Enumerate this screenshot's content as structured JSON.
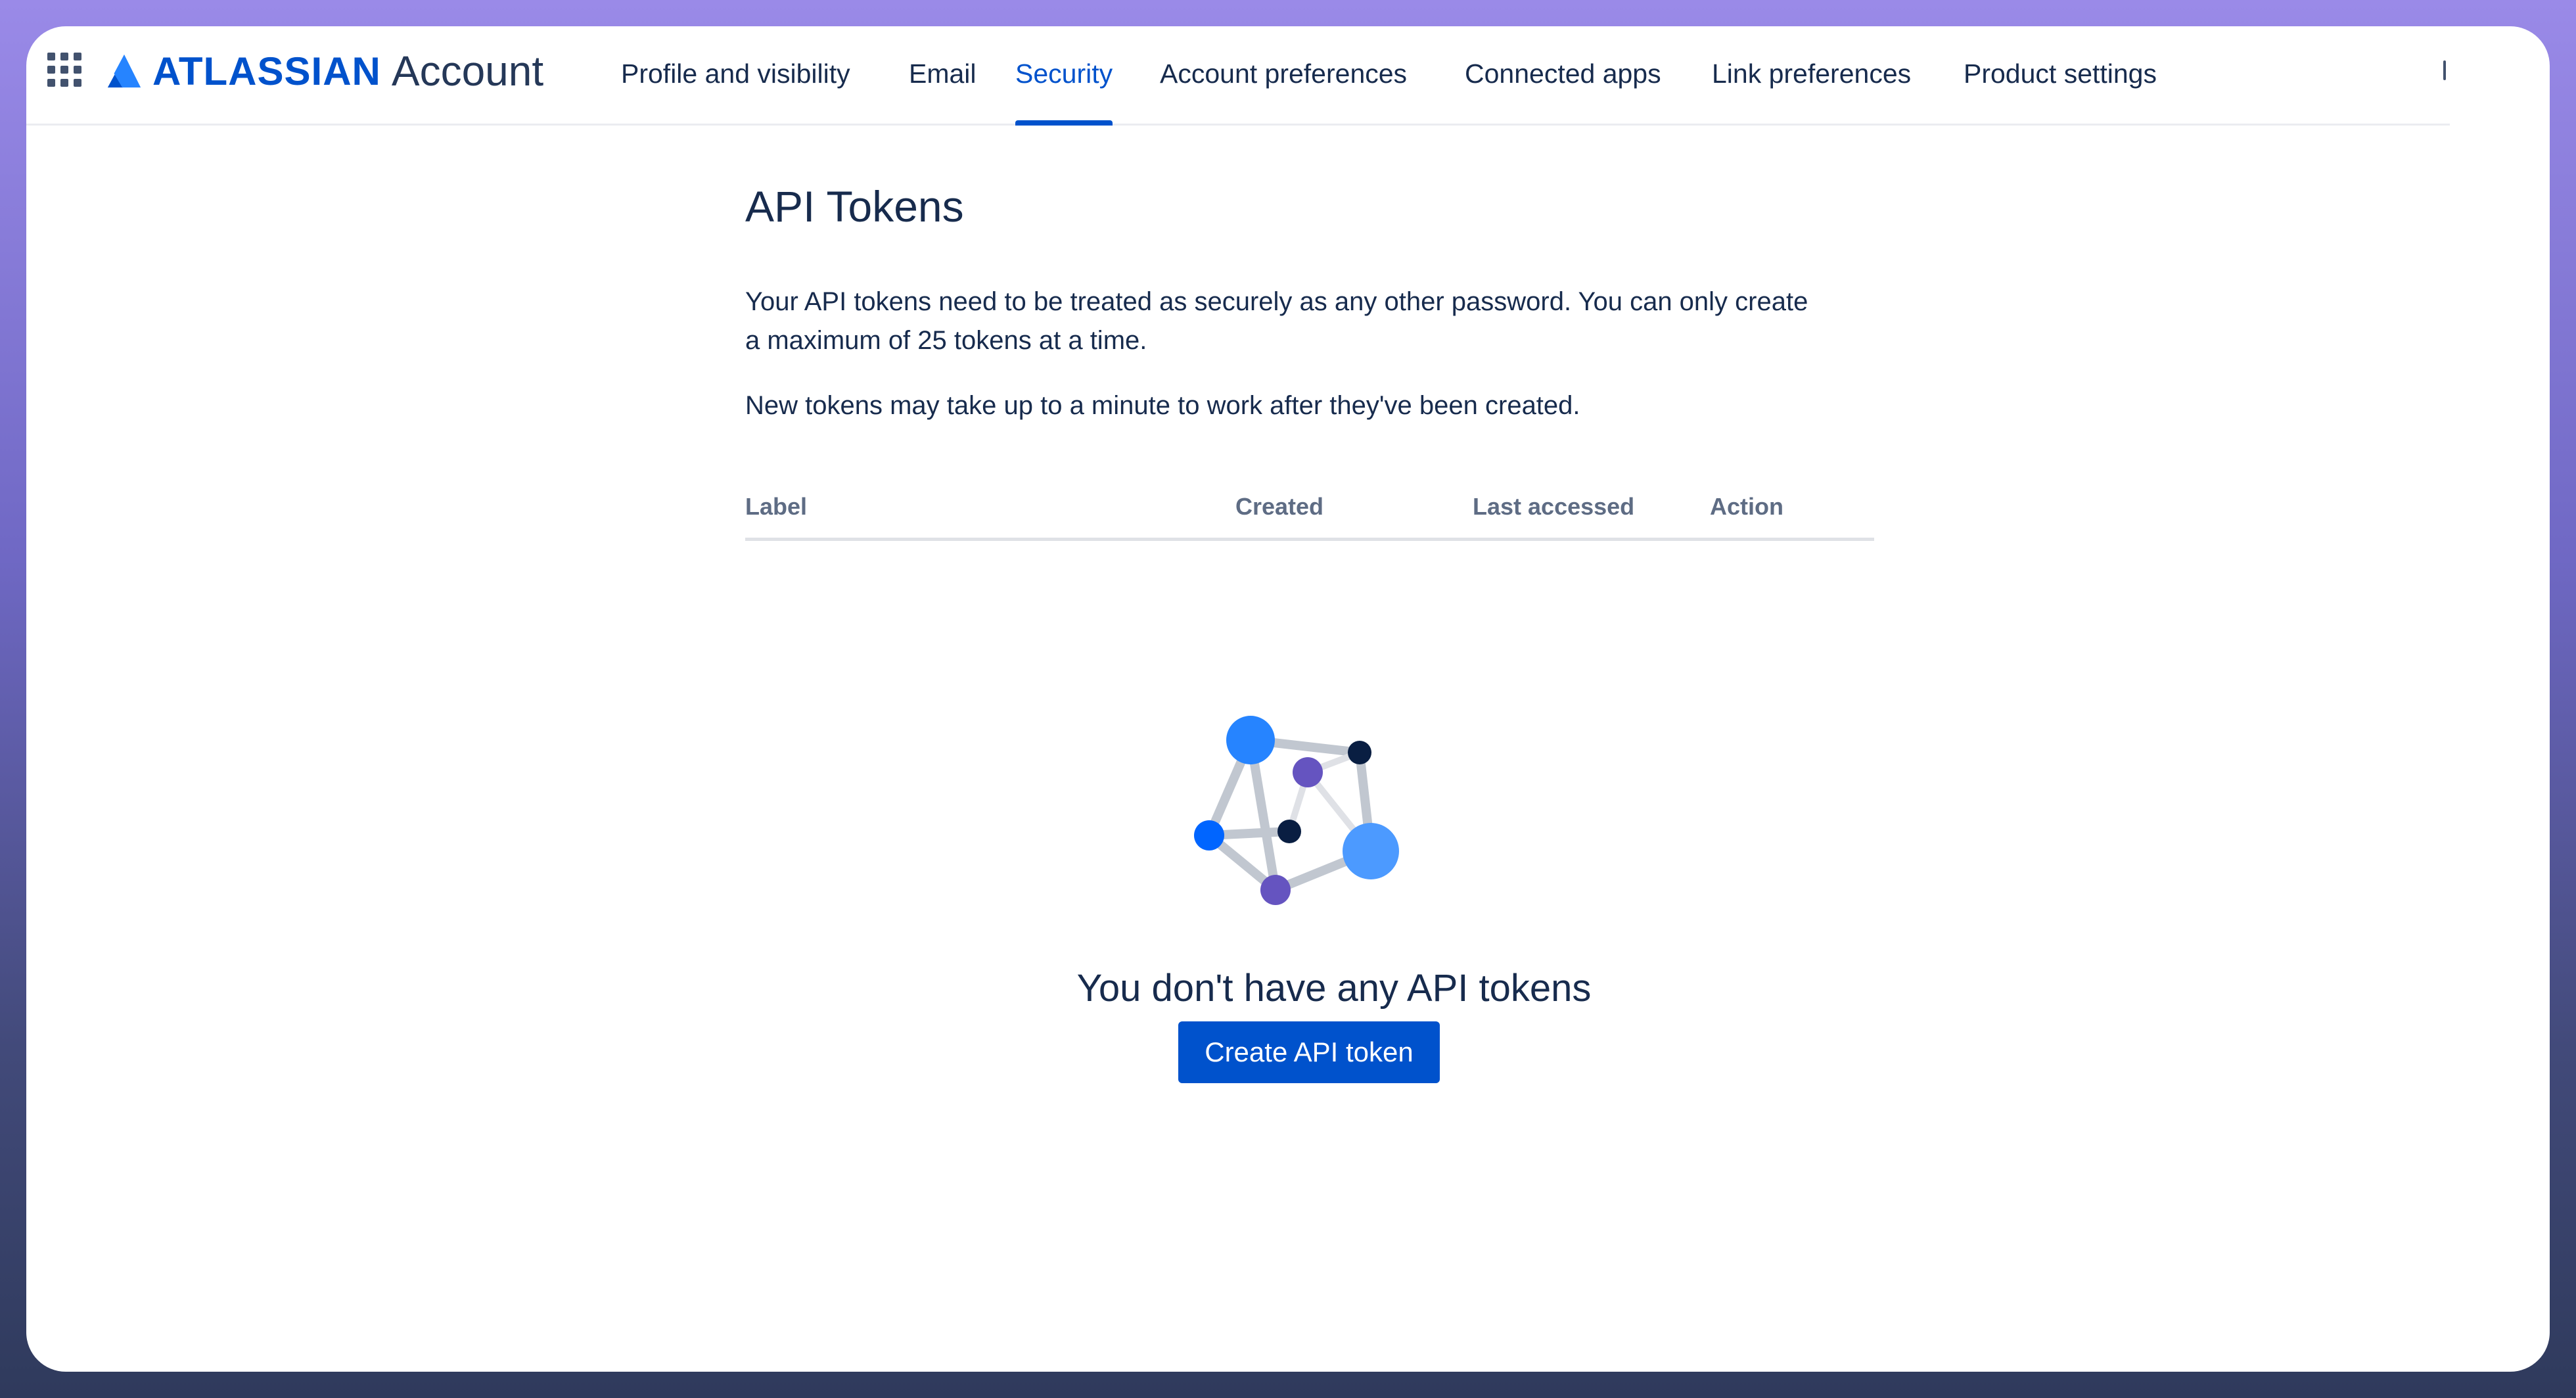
{
  "header": {
    "brand": "ATLASSIAN",
    "product": "Account",
    "nav": [
      {
        "label": "Profile and visibility"
      },
      {
        "label": "Email"
      },
      {
        "label": "Security"
      },
      {
        "label": "Account preferences"
      },
      {
        "label": "Connected apps"
      },
      {
        "label": "Link preferences"
      },
      {
        "label": "Product settings"
      }
    ],
    "active_nav": "Security",
    "icons": [
      "app-switcher-icon",
      "atlassian-logo-icon"
    ]
  },
  "main": {
    "title": "API Tokens",
    "description": "Your API tokens need to be treated as securely as any other password. You can only create a maximum of 25 tokens at a time.",
    "note": "New tokens may take up to a minute to work after they've been created.",
    "table": {
      "columns": [
        "Label",
        "Created",
        "Last accessed",
        "Action"
      ],
      "rows": []
    },
    "empty_state": {
      "illustration": "token-network-illustration",
      "message": "You don't have any API tokens",
      "button_label": "Create API token"
    }
  },
  "colors": {
    "accent": "#0052cc",
    "text": "#172b4d",
    "muted": "#5e6c84",
    "divider": "#dfe1e6"
  }
}
